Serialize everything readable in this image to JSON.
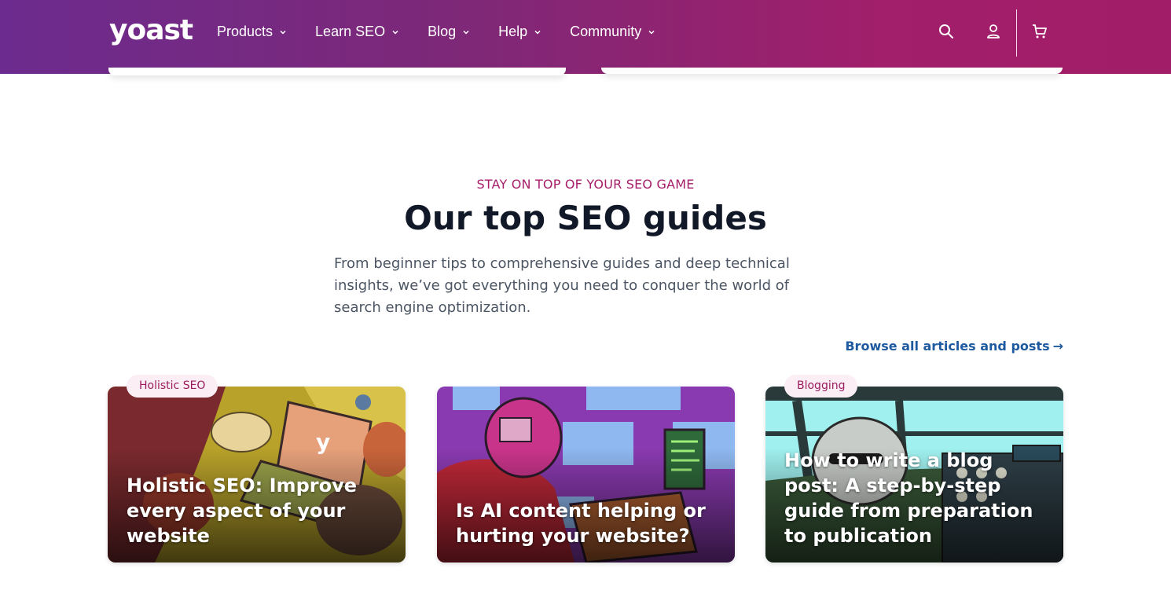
{
  "header": {
    "logo": "yoast",
    "nav": [
      {
        "label": "Products"
      },
      {
        "label": "Learn SEO"
      },
      {
        "label": "Blog"
      },
      {
        "label": "Help"
      },
      {
        "label": "Community"
      }
    ],
    "icons": [
      "search-icon",
      "user-icon",
      "cart-icon"
    ]
  },
  "section": {
    "eyebrow": "STAY ON TOP OF YOUR SEO GAME",
    "title": "Our top SEO guides",
    "description": "From beginner tips to comprehensive guides and deep technical insights, we’ve got everything you need to conquer the world of search engine optimization.",
    "browse_link": "Browse all articles and posts"
  },
  "cards": [
    {
      "badge": "Holistic SEO",
      "title": "Holistic SEO: Improve every aspect of your website"
    },
    {
      "badge": "",
      "title": "Is AI content helping or hurting your website?"
    },
    {
      "badge": "Blogging",
      "title": "How to write a blog post: A step-by-step guide from preparation to publication"
    }
  ],
  "colors": {
    "brand_purple": "#6c2b8e",
    "brand_magenta": "#a61e69",
    "link_blue": "#1e5aa0",
    "badge_bg": "#fbeff5"
  }
}
